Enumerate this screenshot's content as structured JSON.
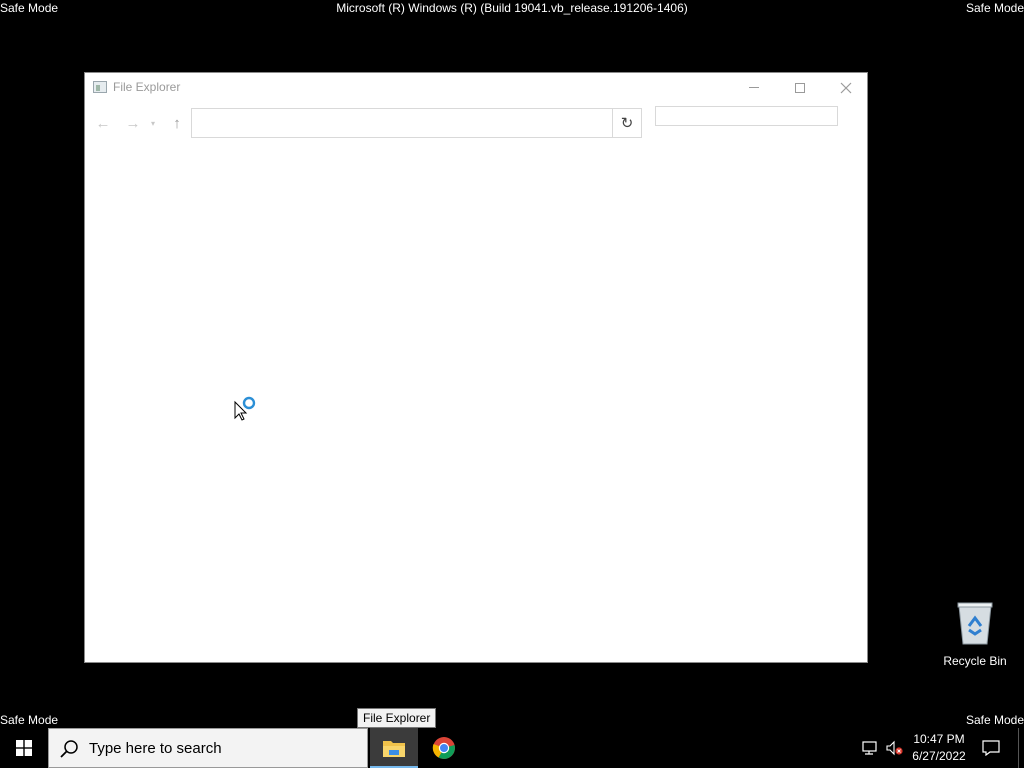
{
  "desktop": {
    "safe_mode_label": "Safe Mode",
    "build_title": "Microsoft (R) Windows (R) (Build 19041.vb_release.191206-1406)",
    "background_color": "#000000",
    "icons": [
      {
        "label": "Recycle Bin",
        "icon": "recycle-bin-icon"
      }
    ]
  },
  "window": {
    "title": "File Explorer",
    "icon": "file-explorer-icon",
    "controls": {
      "minimize": "minimize-icon",
      "maximize": "maximize-icon",
      "close": "close-icon"
    },
    "nav": {
      "back": "←",
      "forward": "→",
      "recent": "▾",
      "up": "↑",
      "address_value": "",
      "dropdown": "⌄",
      "refresh": "↻",
      "search_placeholder": ""
    }
  },
  "tooltip": {
    "text": "File Explorer"
  },
  "taskbar": {
    "search_placeholder": "Type here to search",
    "pinned": [
      {
        "name": "File Explorer",
        "icon": "folder-icon",
        "active": true
      },
      {
        "name": "Google Chrome",
        "icon": "chrome-icon",
        "active": false
      }
    ],
    "clock": {
      "time": "10:47 PM",
      "date": "6/27/2022"
    },
    "accent": "#76b9ed"
  }
}
